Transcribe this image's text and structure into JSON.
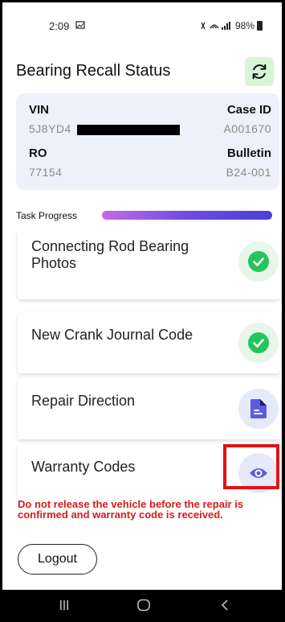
{
  "status_bar": {
    "time": "2:09",
    "battery": "98%",
    "icons": [
      "image-icon",
      "mute-icon",
      "wifi-icon",
      "signal-icon",
      "battery-icon"
    ]
  },
  "header": {
    "title": "Bearing Recall Status",
    "refresh_icon": "refresh-icon"
  },
  "info": {
    "vin_label": "VIN",
    "vin_value": "5J8YD4",
    "case_label": "Case ID",
    "case_value": "A001670",
    "ro_label": "RO",
    "ro_value": "77154",
    "bulletin_label": "Bulletin",
    "bulletin_value": "B24-001"
  },
  "progress": {
    "label": "Task Progress",
    "value_fraction": 1.0
  },
  "tasks": [
    {
      "label": "Connecting Rod Bearing Photos",
      "status": "complete",
      "icon": "check-icon"
    },
    {
      "label": "New Crank Journal Code",
      "status": "complete",
      "icon": "check-icon"
    },
    {
      "label": "Repair Direction",
      "status": "document",
      "icon": "document-icon"
    },
    {
      "label": "Warranty Codes",
      "status": "view",
      "icon": "eye-icon"
    }
  ],
  "warning": "Do not release the vehicle before the repair is confirmed and warranty code is received.",
  "logout_label": "Logout",
  "colors": {
    "accent_green": "#22c55e",
    "accent_purple": "#5b5be0",
    "warning_red": "#d41c1c",
    "highlight_red": "#e01313"
  }
}
